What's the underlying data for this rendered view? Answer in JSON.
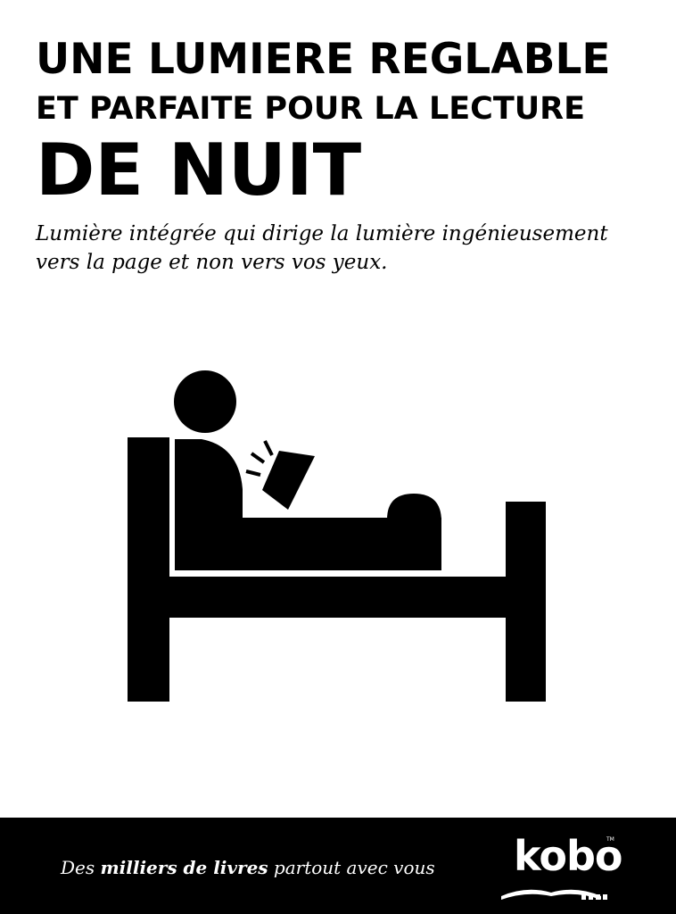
{
  "headline": {
    "line1": "UNE LUMIERE REGLABLE",
    "line2": "ET PARFAITE POUR LA LECTURE",
    "line3": "DE NUIT"
  },
  "subtitle": {
    "line1": "Lumière intégrée qui dirige la lumière ingénieusement",
    "line2": "vers la page et non vers vos yeux."
  },
  "illustration": {
    "icon": "person-reading-in-bed-icon"
  },
  "footer": {
    "tagline_start": "Des ",
    "tagline_bold": "milliers de livres",
    "tagline_end": " partout avec vous",
    "logo_text": "kobo",
    "logo_icon": "kobo-logo-icon"
  },
  "colors": {
    "ink": "#000000",
    "paper": "#ffffff"
  }
}
